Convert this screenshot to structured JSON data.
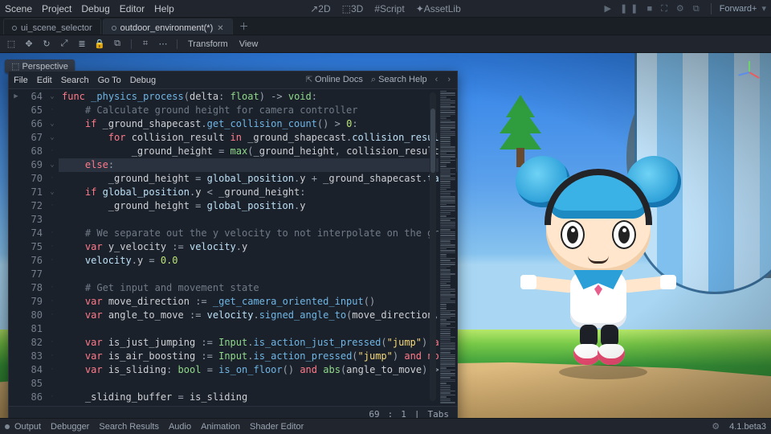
{
  "menu": {
    "items": [
      "Scene",
      "Project",
      "Debug",
      "Editor",
      "Help"
    ]
  },
  "workspace_tabs": {
    "items": [
      {
        "label": "2D",
        "prefix": "↗",
        "active": false
      },
      {
        "label": "3D",
        "prefix": "⬚",
        "active": true
      },
      {
        "label": "Script",
        "prefix": "#",
        "active": false
      },
      {
        "label": "AssetLib",
        "prefix": "✦",
        "active": false
      }
    ]
  },
  "play_controls": {
    "renderer": "Forward+"
  },
  "scene_tabs": {
    "items": [
      {
        "label": "ui_scene_selector",
        "active": false,
        "dirty": false
      },
      {
        "label": "outdoor_environment(*)",
        "active": true,
        "dirty": true
      }
    ]
  },
  "viewport_toolbar": {
    "dropdowns": [
      "Transform",
      "View"
    ]
  },
  "viewport": {
    "badge": "Perspective"
  },
  "script_panel": {
    "menu": [
      "File",
      "Edit",
      "Search",
      "Go To",
      "Debug"
    ],
    "right": {
      "online_docs": "Online Docs",
      "search_help": "Search Help"
    },
    "first_line": 64,
    "cursor_line": 69,
    "fold_rows": [
      64,
      66,
      67,
      69,
      71
    ],
    "lines": [
      {
        "t": "<span class='kw'>func</span> <span class='fn'>_physics_process</span><span class='op'>(</span>delta<span class='op'>:</span> <span class='ty'>float</span><span class='op'>)</span> <span class='op'>-></span> <span class='ty'>void</span><span class='op'>:</span>",
        "i": 0
      },
      {
        "t": "<span class='cmt'># Calculate ground height for camera controller</span>",
        "i": 1
      },
      {
        "t": "<span class='kw'>if</span> _ground_shapecast<span class='op'>.</span><span class='ann'>get_collision_count</span><span class='op'>()</span> <span class='op'>&gt;</span> <span class='num'>0</span><span class='op'>:</span>",
        "i": 1
      },
      {
        "t": "<span class='kw'>for</span> collision_result <span class='kw'>in</span> _ground_shapecast<span class='op'>.</span><span class='mem'>collision_result</span><span class='op'>:</span>",
        "i": 2
      },
      {
        "t": "_ground_height <span class='op'>=</span> <span class='global'>max</span><span class='op'>(</span>_ground_height<span class='op'>,</span> collision_result<span class='op'>.</span><span class='mem'>poi</span>",
        "i": 3
      },
      {
        "t": "<span class='kw'>else</span><span class='op'>:</span>",
        "i": 1,
        "hl": true
      },
      {
        "t": "_ground_height <span class='op'>=</span> <span class='mem'>global_position</span><span class='op'>.</span>y <span class='op'>+</span> _ground_shapecast<span class='op'>.</span><span class='mem'>target</span>",
        "i": 2
      },
      {
        "t": "<span class='kw'>if</span> <span class='mem'>global_position</span><span class='op'>.</span>y <span class='op'>&lt;</span> _ground_height<span class='op'>:</span>",
        "i": 1
      },
      {
        "t": "_ground_height <span class='op'>=</span> <span class='mem'>global_position</span><span class='op'>.</span>y",
        "i": 2
      },
      {
        "t": "",
        "i": 0
      },
      {
        "t": "<span class='cmt'># We separate out the y velocity to not interpolate on the gravit</span>",
        "i": 1
      },
      {
        "t": "<span class='kw'>var</span> y_velocity <span class='op'>:=</span> <span class='mem'>velocity</span><span class='op'>.</span>y",
        "i": 1
      },
      {
        "t": "<span class='mem'>velocity</span><span class='op'>.</span>y <span class='op'>=</span> <span class='num'>0.0</span>",
        "i": 1
      },
      {
        "t": "",
        "i": 0
      },
      {
        "t": "<span class='cmt'># Get input and movement state</span>",
        "i": 1
      },
      {
        "t": "<span class='kw'>var</span> move_direction <span class='op'>:=</span> <span class='fn'>_get_camera_oriented_input</span><span class='op'>()</span>",
        "i": 1
      },
      {
        "t": "<span class='kw'>var</span> angle_to_move <span class='op'>:=</span> <span class='mem'>velocity</span><span class='op'>.</span><span class='ann'>signed_angle_to</span><span class='op'>(</span>move_direction<span class='op'>,</span> <span class='ty'>Vec</span>",
        "i": 1
      },
      {
        "t": "",
        "i": 0
      },
      {
        "t": "<span class='kw'>var</span> is_just_jumping <span class='op'>:=</span> <span class='global'>Input</span><span class='op'>.</span><span class='ann'>is_action_just_pressed</span><span class='op'>(</span><span class='str'>\"jump\"</span><span class='op'>)</span> <span class='kw'>and</span> i",
        "i": 1
      },
      {
        "t": "<span class='kw'>var</span> is_air_boosting <span class='op'>:=</span> <span class='global'>Input</span><span class='op'>.</span><span class='ann'>is_action_pressed</span><span class='op'>(</span><span class='str'>\"jump\"</span><span class='op'>)</span> <span class='kw'>and</span> <span class='kw'>not</span> is",
        "i": 1
      },
      {
        "t": "<span class='kw'>var</span> is_sliding<span class='op'>:</span> <span class='ty'>bool</span> <span class='op'>=</span> <span class='ann'>is_on_floor</span><span class='op'>()</span> <span class='kw'>and</span> <span class='global'>abs</span><span class='op'>(</span>angle_to_move<span class='op'>)</span> <span class='op'>&gt;</span> <span class='op'>(</span><span class='global'>PI</span>",
        "i": 1
      },
      {
        "t": "",
        "i": 0
      },
      {
        "t": "_sliding_buffer <span class='op'>=</span> is_sliding",
        "i": 1
      }
    ],
    "status": {
      "line": 69,
      "col": 1,
      "indent": "Tabs"
    }
  },
  "bottom_panel": {
    "items": [
      "Output",
      "Debugger",
      "Search Results",
      "Audio",
      "Animation",
      "Shader Editor"
    ],
    "version": "4.1.beta3"
  }
}
